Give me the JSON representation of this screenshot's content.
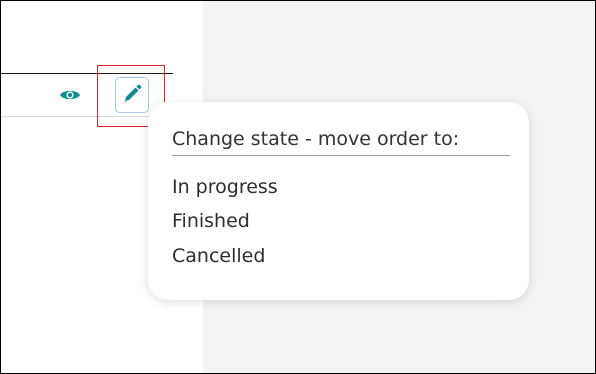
{
  "colors": {
    "accent": "#0f8a8f",
    "highlight": "#d8242c",
    "panel_background": "#f3f3f3"
  },
  "row_actions": {
    "view_icon": "eye-icon",
    "edit_icon": "pencil-icon"
  },
  "state_menu": {
    "title": "Change state - move order to:",
    "items": [
      {
        "label": "In progress"
      },
      {
        "label": "Finished"
      },
      {
        "label": "Cancelled"
      }
    ]
  }
}
